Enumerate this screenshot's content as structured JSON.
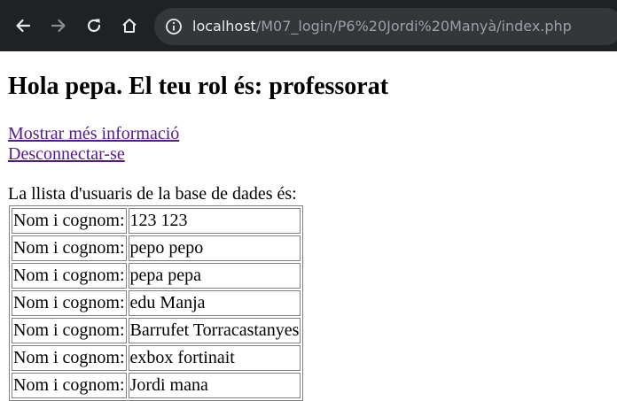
{
  "browser": {
    "url_host": "localhost",
    "url_path": "/M07_login/P6%20Jordi%20Manyà/index.php",
    "icons": {
      "back": "arrow-left-icon",
      "forward": "arrow-right-icon",
      "reload": "reload-icon",
      "home": "home-icon",
      "info": "info-icon"
    }
  },
  "page": {
    "heading": "Hola pepa. El teu rol és: professorat",
    "links": {
      "more_info": "Mostrar més informació",
      "logout": "Desconnectar-se"
    },
    "list_intro": "La llista d'usuaris de la base de dades és:",
    "users": [
      {
        "label": "Nom i cognom:",
        "name": "123 123"
      },
      {
        "label": "Nom i cognom:",
        "name": "pepo pepo"
      },
      {
        "label": "Nom i cognom:",
        "name": "pepa pepa"
      },
      {
        "label": "Nom i cognom:",
        "name": "edu Manja"
      },
      {
        "label": "Nom i cognom:",
        "name": "Barrufet Torracastanyes"
      },
      {
        "label": "Nom i cognom:",
        "name": "exbox fortinait"
      },
      {
        "label": "Nom i cognom:",
        "name": "Jordi mana"
      }
    ]
  },
  "colors": {
    "toolbar_bg": "#202124",
    "omnibox_bg": "#35363a",
    "link_visited": "#551a8b"
  }
}
